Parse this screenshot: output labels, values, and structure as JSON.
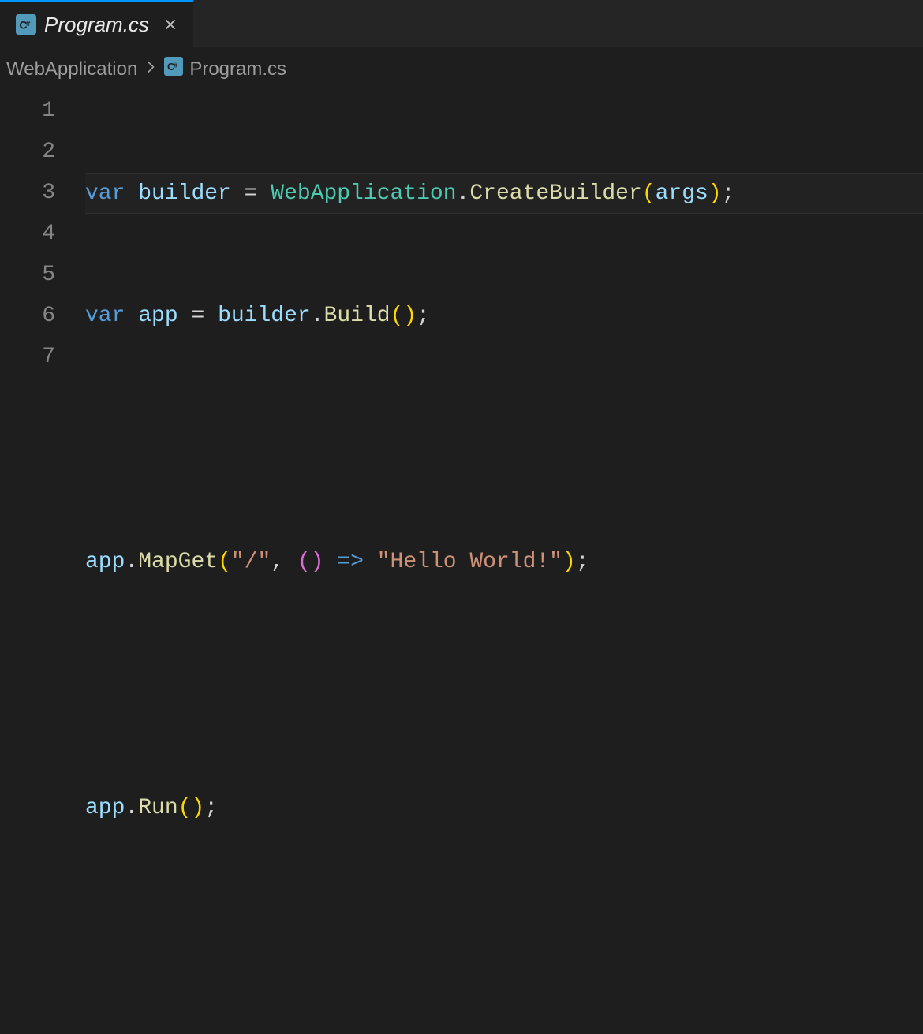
{
  "tab": {
    "label": "Program.cs",
    "icon": "csharp-icon"
  },
  "breadcrumbs": {
    "items": [
      {
        "label": "WebApplication"
      },
      {
        "label": "Program.cs",
        "icon": "csharp-icon"
      }
    ]
  },
  "editor": {
    "lineNumbers": [
      "1",
      "2",
      "3",
      "4",
      "5",
      "6",
      "7"
    ],
    "code": {
      "line1": {
        "var": "var",
        "builder": "builder",
        "eq": " = ",
        "type": "WebApplication",
        "dot1": ".",
        "method": "CreateBuilder",
        "lp": "(",
        "args": "args",
        "rp": ")",
        "semi": ";"
      },
      "line2": {
        "var": "var",
        "app": "app",
        "eq": " = ",
        "builder": "builder",
        "dot": ".",
        "method": "Build",
        "lp": "(",
        "rp": ")",
        "semi": ";"
      },
      "line4": {
        "app": "app",
        "dot": ".",
        "method": "MapGet",
        "lp": "(",
        "str1": "\"/\"",
        "comma": ", ",
        "lp2": "(",
        "rp2": ")",
        "arrow": " => ",
        "str2": "\"Hello World!\"",
        "rp": ")",
        "semi": ";"
      },
      "line6": {
        "app": "app",
        "dot": ".",
        "method": "Run",
        "lp": "(",
        "rp": ")",
        "semi": ";"
      }
    }
  }
}
